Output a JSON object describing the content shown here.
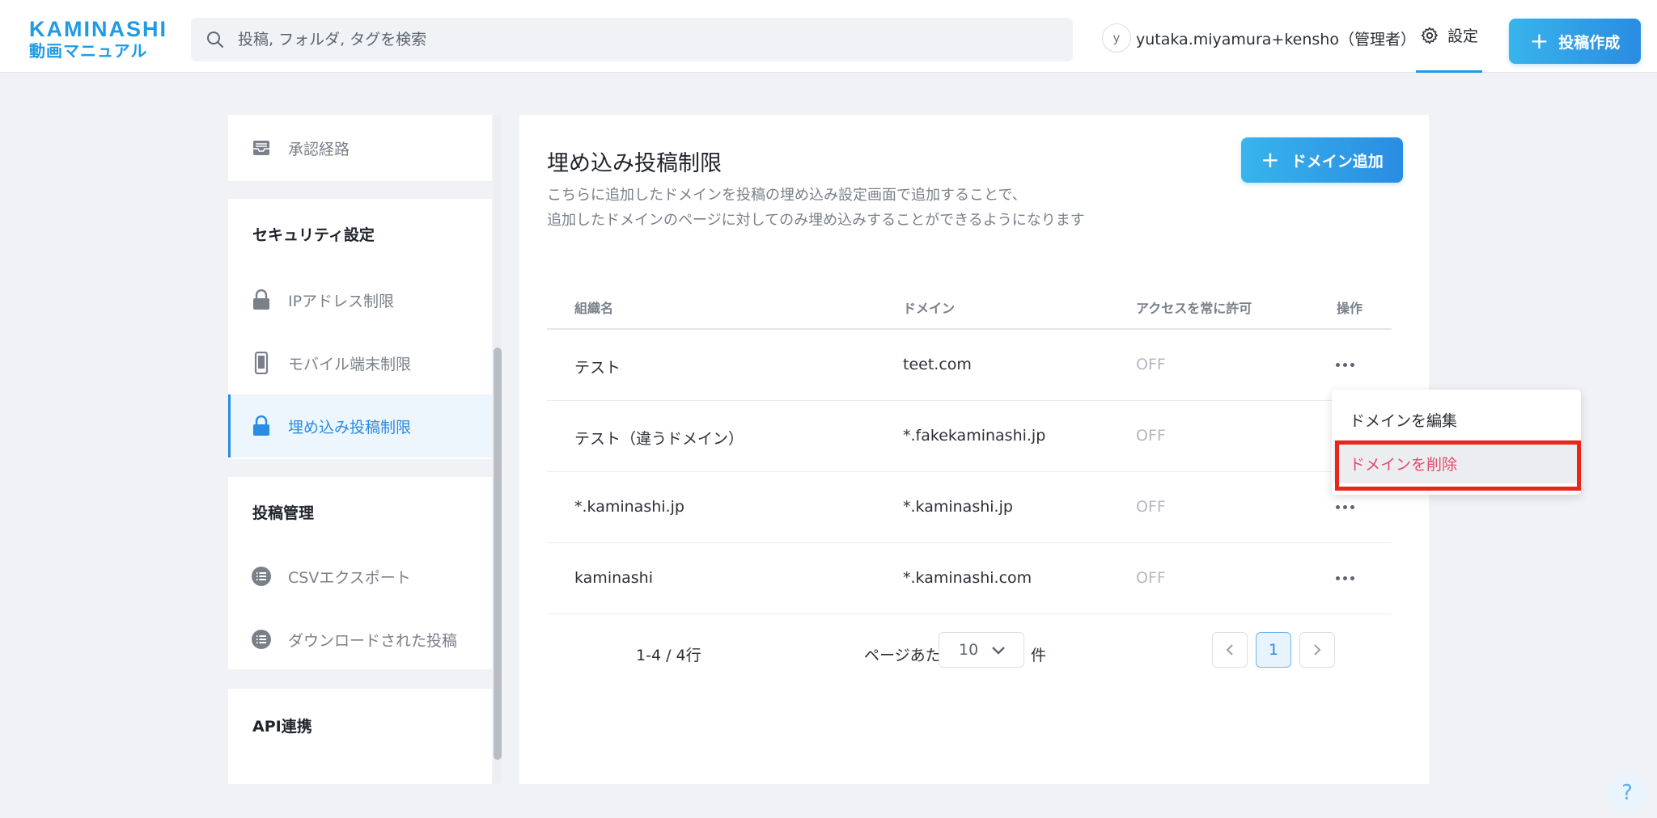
{
  "header": {
    "logo_top": "KAMINASHI",
    "logo_bottom": "動画マニュアル",
    "search_placeholder": "投稿, フォルダ, タグを検索",
    "avatar_initial": "y",
    "user_name": "yutaka.miyamura+kensho（管理者）",
    "settings_label": "設定",
    "create_label": "投稿作成",
    "accent_color": "#1e9be6"
  },
  "sidebar": {
    "approval_route": "承認経路",
    "security_section": "セキュリティ設定",
    "security_items": [
      {
        "label": "IPアドレス制限",
        "icon": "lock-icon"
      },
      {
        "label": "モバイル端末制限",
        "icon": "mobile-icon"
      },
      {
        "label": "埋め込み投稿制限",
        "icon": "lock-icon",
        "active": true
      }
    ],
    "post_section": "投稿管理",
    "post_items": [
      {
        "label": "CSVエクスポート",
        "icon": "list-icon"
      },
      {
        "label": "ダウンロードされた投稿",
        "icon": "list-icon"
      }
    ],
    "api_section": "API連携"
  },
  "main": {
    "title": "埋め込み投稿制限",
    "description_line1": "こちらに追加したドメインを投稿の埋め込み設定画面で追加することで、",
    "description_line2": "追加したドメインのページに対してのみ埋め込みすることができるようになります",
    "add_button": "ドメイン追加",
    "columns": [
      "組織名",
      "ドメイン",
      "アクセスを常に許可",
      "操作"
    ],
    "rows": [
      {
        "org": "テスト",
        "domain": "teet.com",
        "access": "OFF"
      },
      {
        "org": "テスト（違うドメイン）",
        "domain": "*.fakekaminashi.jp",
        "access": "OFF"
      },
      {
        "org": "*.kaminashi.jp",
        "domain": "*.kaminashi.jp",
        "access": "OFF"
      },
      {
        "org": "kaminashi",
        "domain": "*.kaminashi.com",
        "access": "OFF"
      }
    ],
    "pagination": {
      "range": "1-4 / 4行",
      "per_page_label": "ページあたり",
      "per_page_value": "10",
      "per_page_unit": "件",
      "current_page": "1"
    }
  },
  "menu": {
    "edit": "ドメインを編集",
    "delete": "ドメインを削除"
  },
  "help": "?"
}
